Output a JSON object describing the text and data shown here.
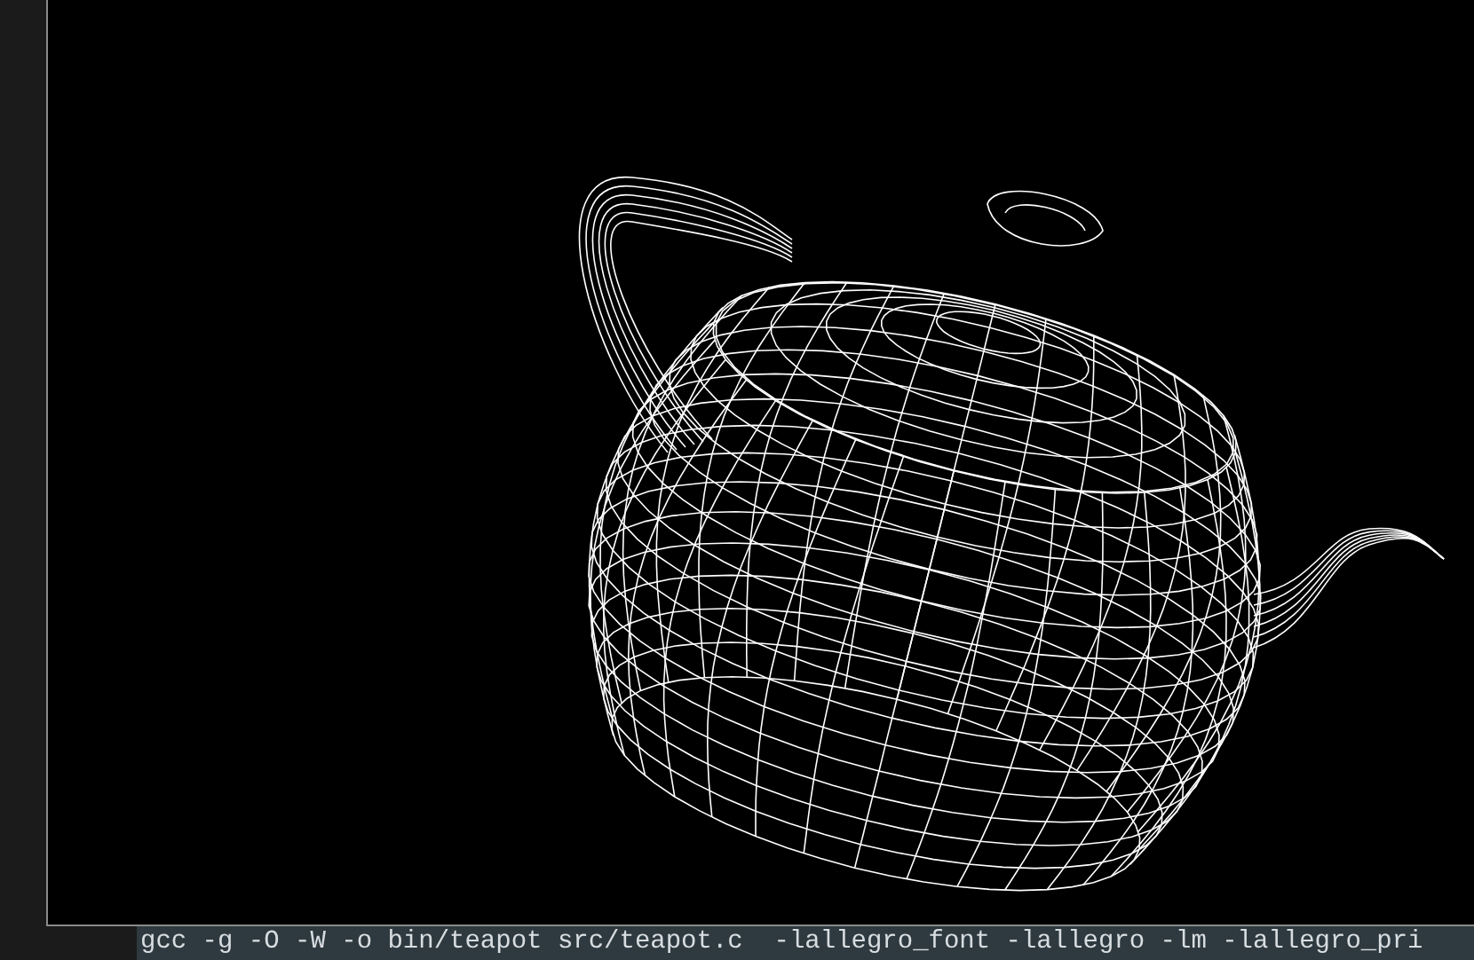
{
  "terminal": {
    "lines": [
      "gcc -g -O -W -o bin/teapot src/teapot.c  -lallegro_font -lallegro -lm -lallegro_pri"
    ]
  }
}
